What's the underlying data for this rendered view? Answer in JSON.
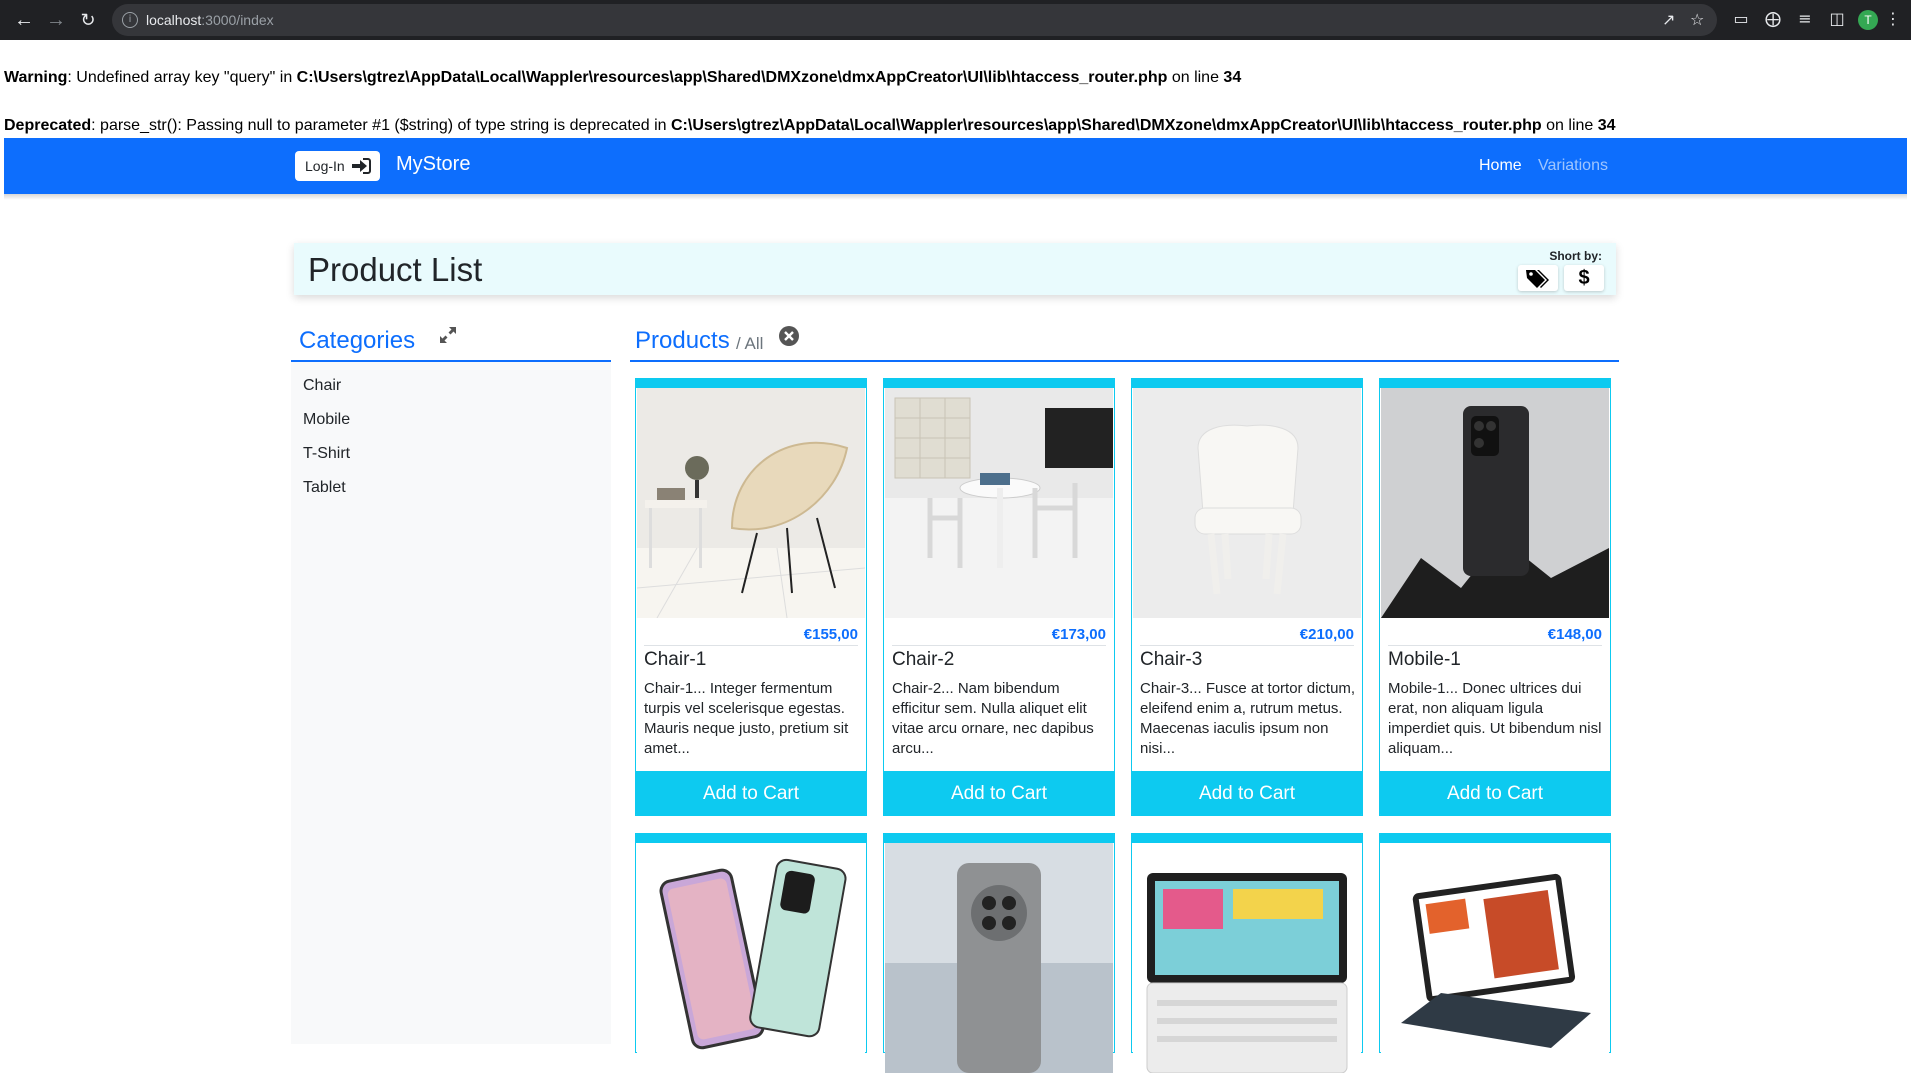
{
  "browser": {
    "url_host": "localhost",
    "url_path": ":3000/index",
    "profile_initial": "T"
  },
  "php_messages": [
    {
      "level": "Warning",
      "pre": ": Undefined array key \"query\" in ",
      "file": "C:\\Users\\gtrez\\AppData\\Local\\Wappler\\resources\\app\\Shared\\DMXzone\\dmxAppCreator\\UI\\lib\\htaccess_router.php",
      "mid": " on line ",
      "line": "34"
    },
    {
      "level": "Deprecated",
      "pre": ": parse_str(): Passing null to parameter #1 ($string) of type string is deprecated in ",
      "file": "C:\\Users\\gtrez\\AppData\\Local\\Wappler\\resources\\app\\Shared\\DMXzone\\dmxAppCreator\\UI\\lib\\htaccess_router.php",
      "mid": " on line ",
      "line": "34"
    }
  ],
  "navbar": {
    "login_label": "Log-In",
    "brand": "MyStore",
    "links": [
      "Home",
      "Variations"
    ],
    "color": "#0d6efd"
  },
  "header": {
    "title": "Product List",
    "sort_label": "Short by:"
  },
  "categories": {
    "title": "Categories",
    "items": [
      "Chair",
      "Mobile",
      "T-Shirt",
      "Tablet"
    ]
  },
  "products": {
    "title": "Products",
    "filter": "/ All",
    "cart_label": "Add to Cart",
    "accent": "#0dcaf0",
    "items": [
      {
        "name": "Chair-1",
        "price": "€155,00",
        "desc": "Chair-1... Integer fermentum turpis vel scelerisque egestas. Mauris neque justo, pretium sit amet..."
      },
      {
        "name": "Chair-2",
        "price": "€173,00",
        "desc": "Chair-2... Nam bibendum efficitur sem. Nulla aliquet elit vitae arcu ornare, nec dapibus arcu..."
      },
      {
        "name": "Chair-3",
        "price": "€210,00",
        "desc": "Chair-3... Fusce at tortor dictum, eleifend enim a, rutrum metus. Maecenas iaculis ipsum non nisi..."
      },
      {
        "name": "Mobile-1",
        "price": "€148,00",
        "desc": "Mobile-1... Donec ultrices dui erat, non aliquam ligula imperdiet quis. Ut bibendum nisl aliquam..."
      }
    ]
  }
}
